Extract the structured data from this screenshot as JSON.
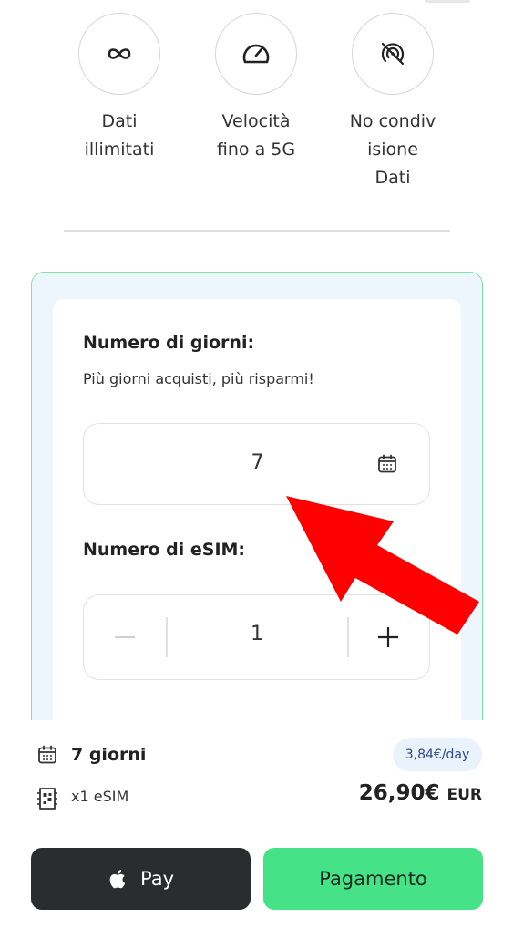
{
  "features": [
    {
      "icon": "infinity-icon",
      "label_lines": [
        "Dati",
        "illimitati"
      ]
    },
    {
      "icon": "speedometer-icon",
      "label_lines": [
        "Velocità",
        "fino a 5G"
      ]
    },
    {
      "icon": "no-hotspot-icon",
      "label_lines": [
        "No condiv",
        "isione",
        "Dati"
      ]
    }
  ],
  "days": {
    "title": "Numero di giorni:",
    "subtitle": "Più giorni acquisti, più risparmi!",
    "value": "7"
  },
  "esim": {
    "title": "Numero di eSIM:",
    "minus": "—",
    "count": "1",
    "plus": "+"
  },
  "summary": {
    "days_label": "7 giorni",
    "per_day": "3,84€/day",
    "esim_label": "x1 eSIM",
    "price": "26,90€",
    "currency": "EUR"
  },
  "buttons": {
    "apple_pay": "Pay",
    "checkout": "Pagamento"
  },
  "colors": {
    "accent_green": "#45e287",
    "arrow_red": "#ff0000",
    "dark_button": "#2b2c2e"
  }
}
